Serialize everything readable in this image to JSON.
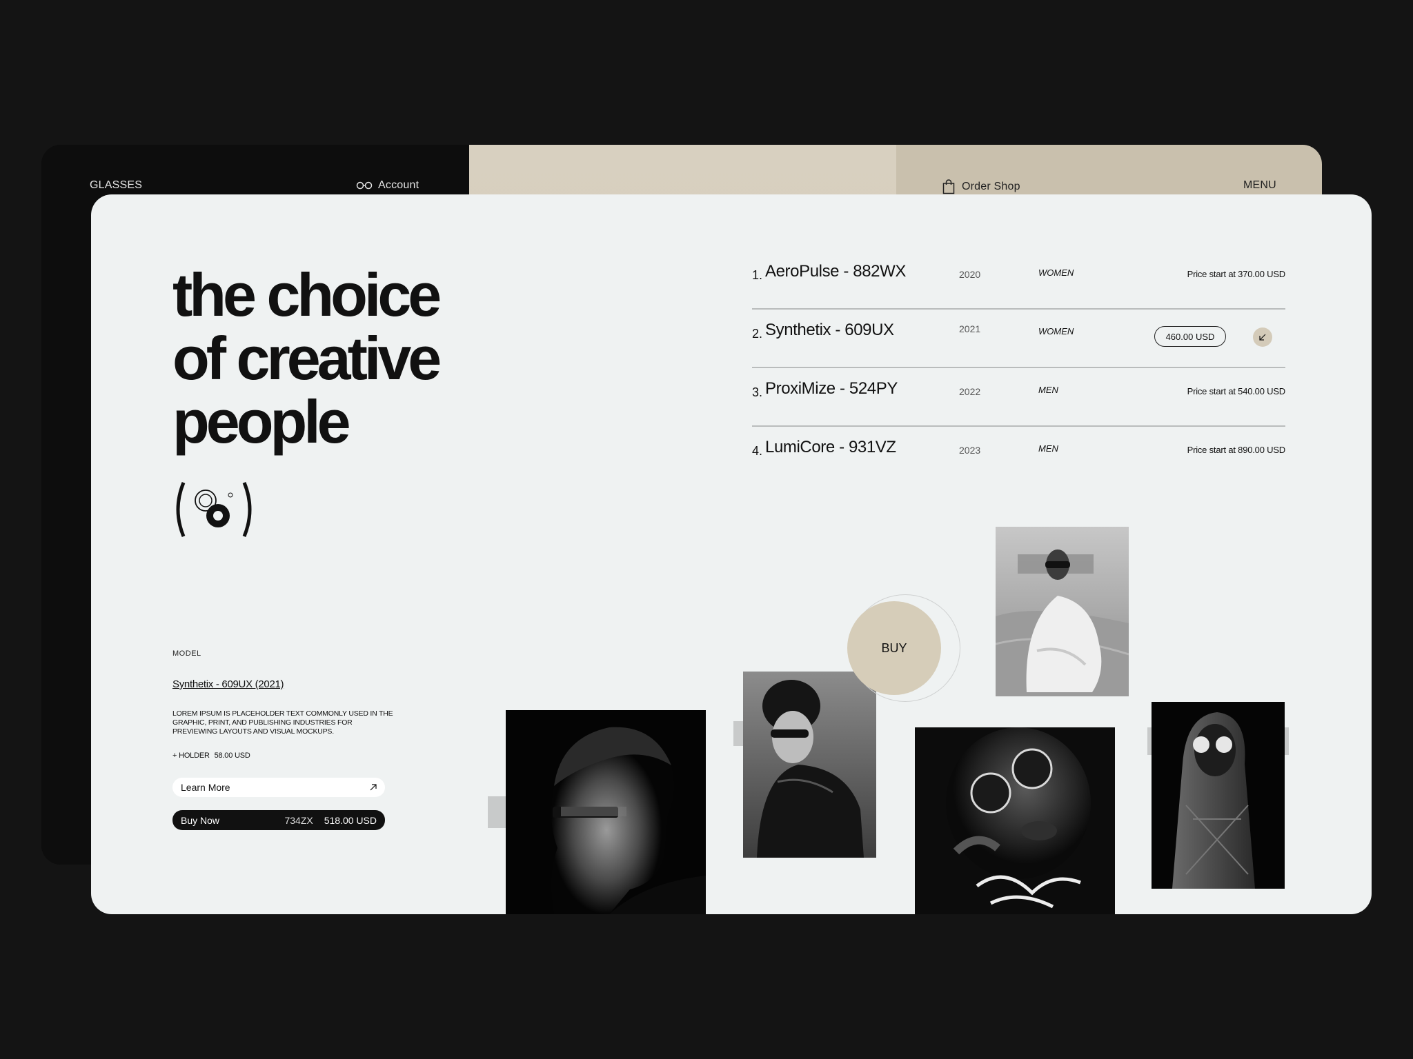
{
  "nav": {
    "brand": "GLASSES",
    "account": "Account",
    "order_shop": "Order Shop",
    "menu": "MENU"
  },
  "hero": {
    "line1": "the choice",
    "line2": "of creative",
    "line3": "people"
  },
  "model": {
    "label": "MODEL",
    "name": "Synthetix - 609UX (2021)",
    "description": "LOREM IPSUM IS PLACEHOLDER TEXT COMMONLY USED IN THE GRAPHIC, PRINT, AND PUBLISHING INDUSTRIES FOR PREVIEWING LAYOUTS AND VISUAL MOCKUPS.",
    "holder_label": "+ HOLDER",
    "holder_price": "58.00 USD"
  },
  "buttons": {
    "learn_more": "Learn More",
    "buy_now": "Buy Now",
    "buy_code": "734ZX",
    "buy_price": "518.00 USD",
    "buy_circle": "BUY"
  },
  "products": [
    {
      "num": "1.",
      "name": "AeroPulse - 882WX",
      "year": "2020",
      "gender": "WOMEN",
      "price": "Price start at 370.00 USD"
    },
    {
      "num": "2.",
      "name": "Synthetix - 609UX",
      "year": "2021",
      "gender": "WOMEN",
      "price": "460.00 USD"
    },
    {
      "num": "3.",
      "name": "ProxiMize - 524PY",
      "year": "2022",
      "gender": "MEN",
      "price": "Price start at 540.00 USD"
    },
    {
      "num": "4.",
      "name": "LumiCore - 931VZ",
      "year": "2023",
      "gender": "MEN",
      "price": "Price start at 890.00 USD"
    }
  ],
  "colors": {
    "background": "#141414",
    "card": "#eff2f2",
    "accent_beige": "#d6cdb9",
    "ink": "#111111"
  },
  "icons": {
    "account": "glasses-icon",
    "order_shop": "shopping-bag-icon",
    "learn_more": "arrow-up-right-icon",
    "selected_row": "arrow-down-left-icon",
    "brand_mark": "logo-icon"
  }
}
